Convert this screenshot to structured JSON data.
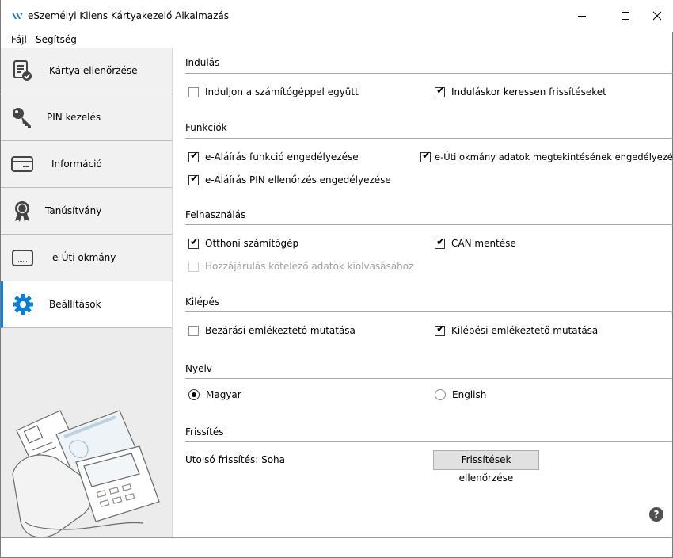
{
  "window": {
    "title": "eSzemélyi Kliens Kártyakezelő Alkalmazás"
  },
  "menu": [
    {
      "accel": "F",
      "rest": "ájl"
    },
    {
      "accel": "S",
      "rest": "egítség"
    }
  ],
  "sidebar": {
    "items": [
      {
        "label": "Kártya ellenőrzése",
        "icon": "card-check-icon"
      },
      {
        "label": "PIN kezelés",
        "icon": "key-icon"
      },
      {
        "label": "Információ",
        "icon": "card-info-icon"
      },
      {
        "label": "Tanúsítvány",
        "icon": "certificate-icon"
      },
      {
        "label": "e-Úti okmány",
        "icon": "passport-icon"
      },
      {
        "label": "Beállítások",
        "icon": "gear-icon"
      }
    ],
    "active_index": 5,
    "accent_color": "#0b7fd4"
  },
  "settings": {
    "startup": {
      "title": "Indulás",
      "start_with_computer": {
        "label": "Induljon a számítógéppel együtt",
        "checked": false
      },
      "check_updates": {
        "label": "Induláskor keressen frissítéseket",
        "checked": true
      }
    },
    "functions": {
      "title": "Funkciók",
      "esign_enable": {
        "label": "e-Aláírás funkció engedélyezése",
        "checked": true
      },
      "etravel_view": {
        "label": "e-Úti okmány adatok megtekintésének engedélyezése",
        "checked": true
      },
      "esign_pin": {
        "label": "e-Aláírás PIN ellenőrzés engedélyezése",
        "checked": true
      }
    },
    "usage": {
      "title": "Felhasználás",
      "home_computer": {
        "label": "Otthoni számítógép",
        "checked": true
      },
      "save_can": {
        "label": "CAN mentése",
        "checked": true
      },
      "consent": {
        "label": "Hozzájárulás kötelező adatok kiolvasásához",
        "checked": false,
        "disabled": true
      }
    },
    "exit": {
      "title": "Kilépés",
      "close_reminder": {
        "label": "Bezárási emlékeztető mutatása",
        "checked": false
      },
      "exit_reminder": {
        "label": "Kilépési emlékeztető mutatása",
        "checked": true
      }
    },
    "language": {
      "title": "Nyelv",
      "options": [
        "Magyar",
        "English"
      ],
      "selected": "Magyar"
    },
    "update": {
      "title": "Frissítés",
      "last_update": "Utolsó frissítés: Soha",
      "check_button": "Frissítések ellenőrzése"
    }
  },
  "help": {
    "glyph": "?"
  }
}
